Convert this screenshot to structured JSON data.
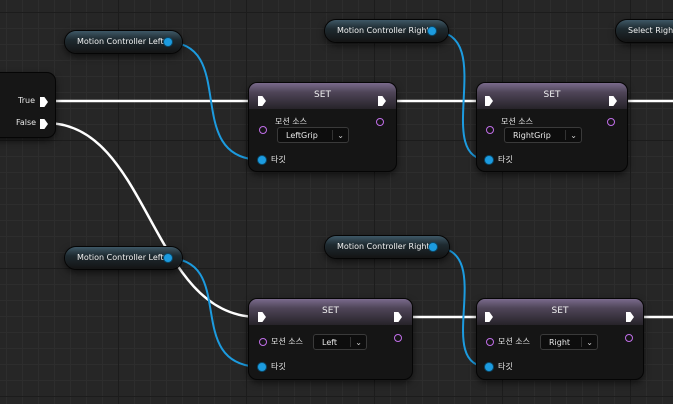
{
  "branch": {
    "true_label": "True",
    "false_label": "False"
  },
  "getters": [
    {
      "label": "Motion Controller Left"
    },
    {
      "label": "Motion Controller Right"
    },
    {
      "label": "Select Righ"
    },
    {
      "label": "Motion Controller Left"
    },
    {
      "label": "Motion Controller Right"
    }
  ],
  "set_nodes": [
    {
      "title": "SET",
      "prop_label": "모션 소스",
      "value": "LeftGrip",
      "target_label": "타깃"
    },
    {
      "title": "SET",
      "prop_label": "모션 소스",
      "value": "RightGrip",
      "target_label": "타깃"
    },
    {
      "title": "SET",
      "prop_label": "모션 소스",
      "value": "Left",
      "target_label": "타깃"
    },
    {
      "title": "SET",
      "prop_label": "모션 소스",
      "value": "Right",
      "target_label": "타깃"
    }
  ],
  "colors": {
    "exec_wire": "#ffffff",
    "object_wire": "#1c9bdf",
    "name_pin": "#c06ee8",
    "set_header": "#7a6a8c"
  }
}
